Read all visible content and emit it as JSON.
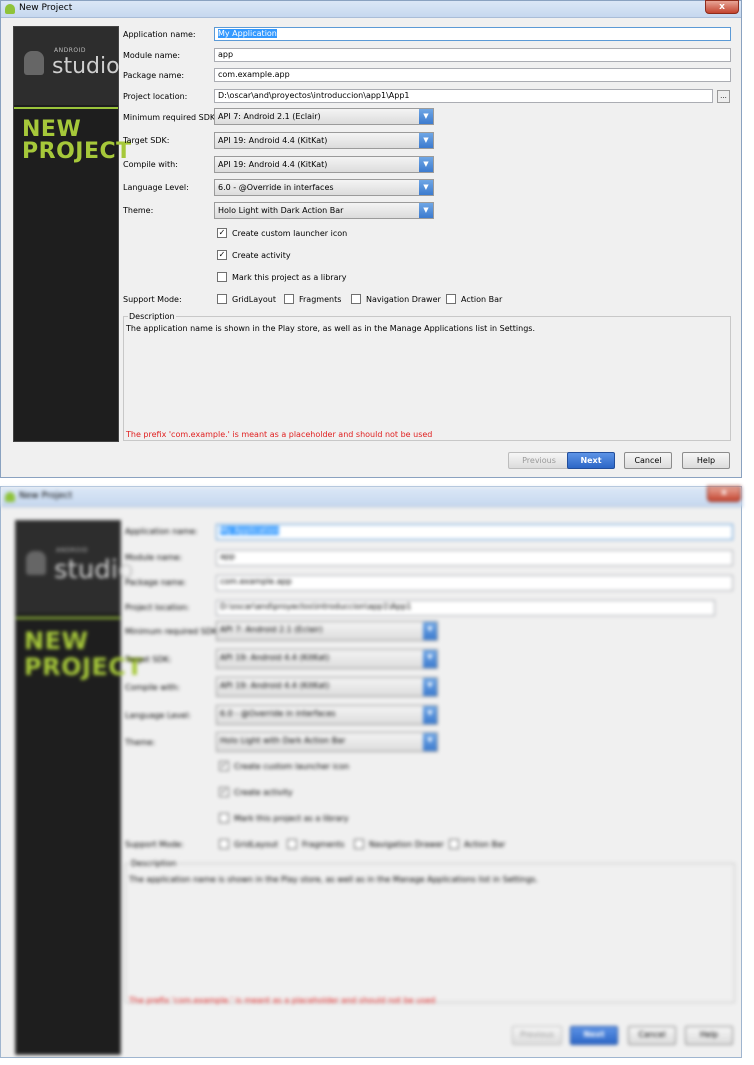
{
  "window": {
    "title": "New Project",
    "close_label": "x"
  },
  "sidebar": {
    "logo_small": "ANDROID",
    "logo_text": "studio",
    "heading_line1": "NEW",
    "heading_line2": "PROJECT"
  },
  "form": {
    "application_name": {
      "label": "Application name:",
      "value": "My Application"
    },
    "module_name": {
      "label": "Module name:",
      "value": "app"
    },
    "package_name": {
      "label": "Package name:",
      "value": "com.example.app"
    },
    "project_location": {
      "label": "Project location:",
      "value": "D:\\oscar\\and\\proyectos\\introduccion\\app1\\App1",
      "browse_label": "..."
    },
    "min_sdk": {
      "label": "Minimum required SDK:",
      "value": "API 7: Android 2.1 (Eclair)"
    },
    "target_sdk": {
      "label": "Target SDK:",
      "value": "API 19: Android 4.4 (KitKat)"
    },
    "compile_with": {
      "label": "Compile with:",
      "value": "API 19: Android 4.4 (KitKat)"
    },
    "language_level": {
      "label": "Language Level:",
      "value": "6.0 - @Override in interfaces"
    },
    "theme": {
      "label": "Theme:",
      "value": "Holo Light with Dark Action Bar"
    },
    "create_launcher_icon": {
      "label": "Create custom launcher icon",
      "checked": true
    },
    "create_activity": {
      "label": "Create activity",
      "checked": true
    },
    "mark_library": {
      "label": "Mark this project as a library",
      "checked": false
    },
    "support_mode": {
      "label": "Support Mode:",
      "options": [
        {
          "label": "GridLayout",
          "checked": false
        },
        {
          "label": "Fragments",
          "checked": false
        },
        {
          "label": "Navigation Drawer",
          "checked": false
        },
        {
          "label": "Action Bar",
          "checked": false
        }
      ]
    }
  },
  "description": {
    "title": "Description",
    "text": "The application name is shown in the Play store, as well as in the Manage Applications list in Settings.",
    "warning": "The prefix 'com.example.' is meant as a placeholder and should not be used"
  },
  "buttons": {
    "previous": "Previous",
    "next": "Next",
    "cancel": "Cancel",
    "help": "Help"
  },
  "colors": {
    "accent": "#9ac43b",
    "primary_button": "#2c66c6",
    "warning": "#e02020",
    "sidebar_bg": "#1e1e1e"
  }
}
